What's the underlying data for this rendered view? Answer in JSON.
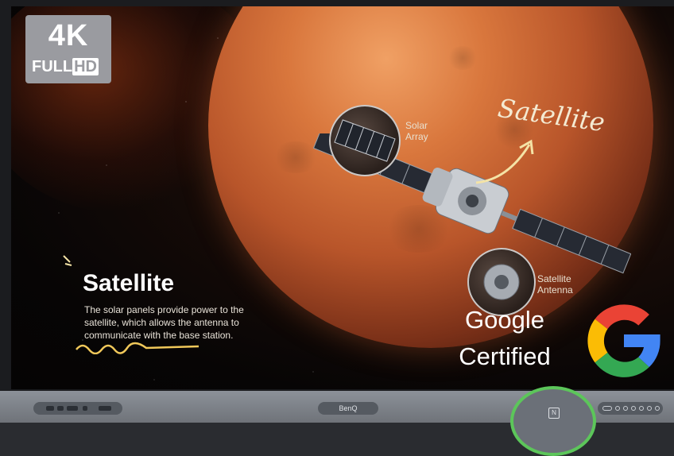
{
  "badge": {
    "resolution": "4K",
    "full": "FULL",
    "hd": "HD"
  },
  "callouts": {
    "cursive_title": "Satellite",
    "solar_array": [
      "Solar",
      "Array"
    ],
    "antenna": [
      "Satellite",
      "Antenna"
    ]
  },
  "content": {
    "title": "Satellite",
    "description": "The solar panels provide power to the satellite, which allows the antenna to communicate with the base station."
  },
  "certification": {
    "line1": "Google",
    "line2": "Certified"
  },
  "bezel": {
    "brand": "BenQ"
  },
  "colors": {
    "nfc_highlight": "#5cc65a",
    "google_red": "#EA4335",
    "google_yellow": "#FBBC05",
    "google_green": "#34A853",
    "google_blue": "#4285F4"
  },
  "icons": {
    "nfc": "nfc-icon",
    "google": "google-g-icon"
  }
}
